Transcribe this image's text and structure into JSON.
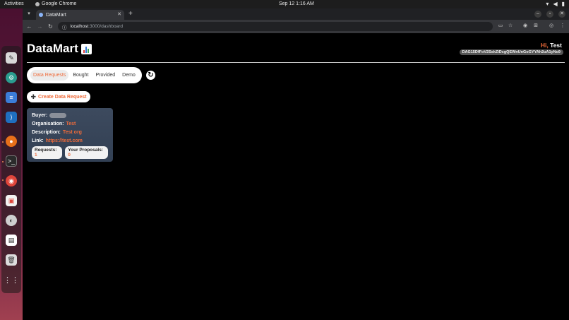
{
  "os": {
    "activities": "Activities",
    "app_name": "Google Chrome",
    "clock": "Sep 12  1:16 AM"
  },
  "browser": {
    "tab_title": "DataMart",
    "url_host": "localhost",
    "url_path": ":3000/dashboard"
  },
  "app": {
    "brand": "DataMart",
    "greeting_hi": "Hi,",
    "greeting_name": "Test",
    "address": "DAG15DfFoV2SskZiDcgQEWnUnGoGYYAh2uA1yNo9",
    "tabs": [
      "Data Requests",
      "Bought",
      "Provided",
      "Demo"
    ],
    "active_tab": "Data Requests",
    "create_button": "Create Data Request",
    "card": {
      "buyer_label": "Buyer:",
      "organisation_label": "Organisation:",
      "organisation": "Test",
      "description_label": "Description:",
      "description": "Test org",
      "link_label": "Link:",
      "link": "https://test.com",
      "requests_label": "Requests:",
      "requests": "1",
      "proposals_label": "Your Proposals:",
      "proposals": "0"
    }
  },
  "colors": {
    "accent": "#ef6b3a",
    "card_bg": "#3d4a5e"
  }
}
